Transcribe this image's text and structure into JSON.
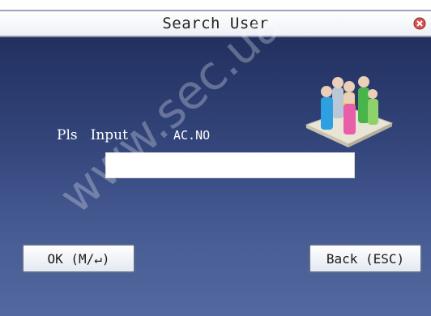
{
  "window": {
    "title": "Search User",
    "close_icon": "close-icon"
  },
  "main": {
    "prompt_words": [
      "Pls",
      "Input",
      "AC.NO"
    ],
    "input_value": "",
    "illustration_icon": "users-group-icon"
  },
  "buttons": {
    "ok_label": "OK (M/↵)",
    "back_label": "Back (ESC)"
  },
  "watermark": "www.sec.ua",
  "colors": {
    "screen_top": "#22305f",
    "screen_bottom": "#54689f",
    "close_red": "#d9534f"
  }
}
